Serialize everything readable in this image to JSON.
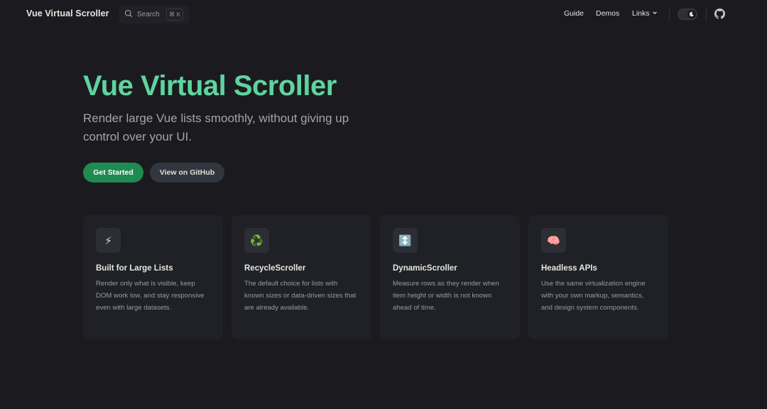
{
  "nav": {
    "brand": "Vue Virtual Scroller",
    "search_placeholder": "Search",
    "search_shortcut": "⌘ K",
    "links": [
      {
        "label": "Guide"
      },
      {
        "label": "Demos"
      },
      {
        "label": "Links",
        "chevron": "⌄"
      }
    ],
    "icons": {
      "search": "search-icon",
      "theme": "moon-icon",
      "github": "github-icon"
    }
  },
  "hero": {
    "title": "Vue Virtual Scroller",
    "tagline": "Render large Vue lists smoothly, without giving up control over your UI.",
    "primary_button": "Get Started",
    "secondary_button": "View on GitHub"
  },
  "features": [
    {
      "icon": "⚡",
      "icon_name": "lightning-icon",
      "title": "Built for Large Lists",
      "desc": "Render only what is visible, keep DOM work low, and stay responsive even with large datasets."
    },
    {
      "icon": "♻️",
      "icon_name": "recycle-icon",
      "title": "RecycleScroller",
      "desc": "The default choice for lists with known sizes or data-driven sizes that are already available."
    },
    {
      "icon": "↕️",
      "icon_name": "up-down-arrow-icon",
      "title": "DynamicScroller",
      "desc": "Measure rows as they render when item height or width is not known ahead of time."
    },
    {
      "icon": "🧠",
      "icon_name": "brain-icon",
      "title": "Headless APIs",
      "desc": "Use the same virtualization engine with your own markup, semantics, and design system components."
    }
  ],
  "colors": {
    "background": "#1b1b1f",
    "accent": "#5fd39f",
    "primary_button": "#1f8a52",
    "card": "#202127"
  }
}
